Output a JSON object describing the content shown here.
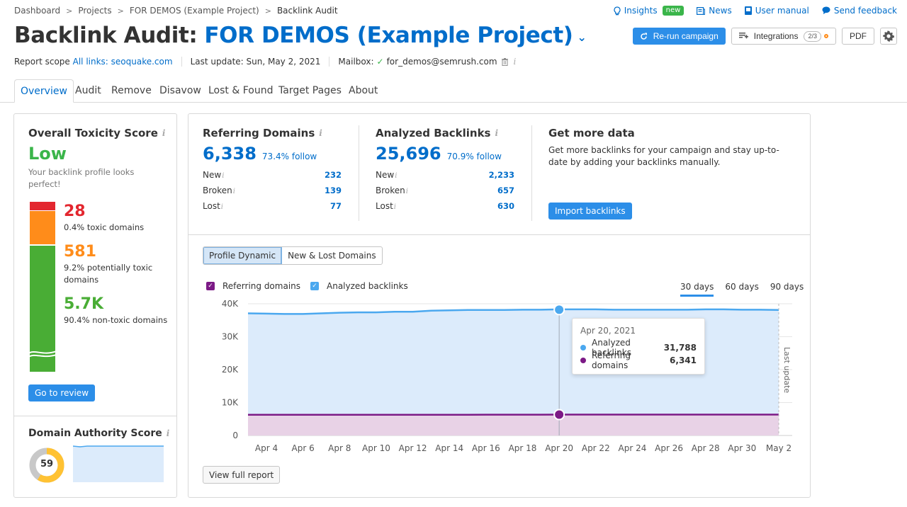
{
  "breadcrumb": [
    "Dashboard",
    "Projects",
    "FOR DEMOS (Example Project)",
    "Backlink Audit"
  ],
  "top_links": {
    "insights": "Insights",
    "insights_badge": "new",
    "news": "News",
    "user_manual": "User manual",
    "send_feedback": "Send feedback"
  },
  "header": {
    "title_prefix": "Backlink Audit:",
    "project_name": "FOR DEMOS (Example Project)",
    "rerun_label": "Re-run campaign",
    "integrations_label": "Integrations",
    "integrations_count": "2/3",
    "pdf_label": "PDF"
  },
  "meta": {
    "scope_label": "Report scope",
    "scope_value": "All links: seoquake.com",
    "last_update": "Last update: Sun, May 2, 2021",
    "mailbox_label": "Mailbox:",
    "mailbox_value": "for_demos@semrush.com"
  },
  "tabs": [
    "Overview",
    "Audit",
    "Remove",
    "Disavow",
    "Lost & Found",
    "Target Pages",
    "About"
  ],
  "active_tab": "Overview",
  "toxicity": {
    "title": "Overall Toxicity Score",
    "level": "Low",
    "description": "Your backlink profile looks perfect!",
    "toxic": {
      "value": "28",
      "label": "0.4% toxic domains",
      "color": "#e3272f"
    },
    "potential": {
      "value": "581",
      "label": "9.2% potentially toxic domains",
      "color": "#ff8c1a"
    },
    "non_toxic": {
      "value": "5.7K",
      "label": "90.4% non-toxic domains",
      "color": "#49ad35"
    },
    "review_label": "Go to review"
  },
  "authority": {
    "title": "Domain Authority Score",
    "score": "59",
    "score_fraction": 0.59
  },
  "referring_domains": {
    "title": "Referring Domains",
    "total": "6,338",
    "follow": "73.4% follow",
    "rows": [
      {
        "label": "New",
        "value": "232"
      },
      {
        "label": "Broken",
        "value": "139"
      },
      {
        "label": "Lost",
        "value": "77"
      }
    ]
  },
  "analyzed_backlinks": {
    "title": "Analyzed Backlinks",
    "total": "25,696",
    "follow": "70.9% follow",
    "rows": [
      {
        "label": "New",
        "value": "2,233"
      },
      {
        "label": "Broken",
        "value": "657"
      },
      {
        "label": "Lost",
        "value": "630"
      }
    ]
  },
  "more_data": {
    "title": "Get more data",
    "text": "Get more backlinks for your campaign and stay up-to-date by adding your backlinks manually.",
    "button": "Import backlinks"
  },
  "chart_panel": {
    "seg_tabs": [
      "Profile Dynamic",
      "New & Lost Domains"
    ],
    "legend": [
      "Referring domains",
      "Analyzed backlinks"
    ],
    "periods": [
      "30 days",
      "60 days",
      "90 days"
    ],
    "active_period": "30 days",
    "last_update_label": "Last update",
    "view_full_report": "View full report",
    "tooltip": {
      "date": "Apr 20, 2021",
      "rows": [
        {
          "name": "Analyzed backlinks",
          "value": "31,788"
        },
        {
          "name": "Referring domains",
          "value": "6,341"
        }
      ]
    }
  },
  "chart_data": {
    "type": "area",
    "title": "",
    "xlabel": "",
    "ylabel": "",
    "ylim": [
      0,
      40000
    ],
    "yticks": [
      "0",
      "10K",
      "20K",
      "30K",
      "40K"
    ],
    "ytick_values": [
      0,
      10000,
      20000,
      30000,
      40000
    ],
    "grid": true,
    "legend_position": "top-left",
    "x_labels": [
      "Apr 4",
      "Apr 6",
      "Apr 8",
      "Apr 10",
      "Apr 12",
      "Apr 14",
      "Apr 16",
      "Apr 18",
      "Apr 20",
      "Apr 22",
      "Apr 24",
      "Apr 26",
      "Apr 28",
      "Apr 30",
      "May 2"
    ],
    "series": [
      {
        "name": "Analyzed backlinks",
        "color": "#4ba8ef",
        "fill": "#dcebfb",
        "values": [
          37100,
          37000,
          36900,
          36900,
          37100,
          37300,
          37400,
          37400,
          37600,
          37600,
          37900,
          38000,
          38100,
          38100,
          38100,
          38200,
          38200,
          38300,
          38300,
          38300,
          38200,
          38200,
          38200,
          38200,
          38200,
          38300,
          38300,
          38200,
          38200,
          38100
        ]
      },
      {
        "name": "Referring domains",
        "color": "#7c1a86",
        "fill": "#e8d2e6",
        "values": [
          6300,
          6300,
          6300,
          6300,
          6300,
          6300,
          6300,
          6300,
          6300,
          6300,
          6300,
          6300,
          6300,
          6320,
          6320,
          6330,
          6330,
          6341,
          6341,
          6341,
          6341,
          6340,
          6340,
          6340,
          6340,
          6340,
          6340,
          6338,
          6338,
          6338
        ]
      }
    ],
    "highlight": {
      "label": "Apr 20",
      "index": 17,
      "analyzed_backlinks": 31788,
      "referring_domains": 6341
    },
    "last_update_marker": "May 2"
  },
  "colors": {
    "accent": "#2c8ee8",
    "link": "#006dca",
    "green": "#49ad35",
    "orange": "#ff8c1a",
    "red": "#e3272f"
  }
}
